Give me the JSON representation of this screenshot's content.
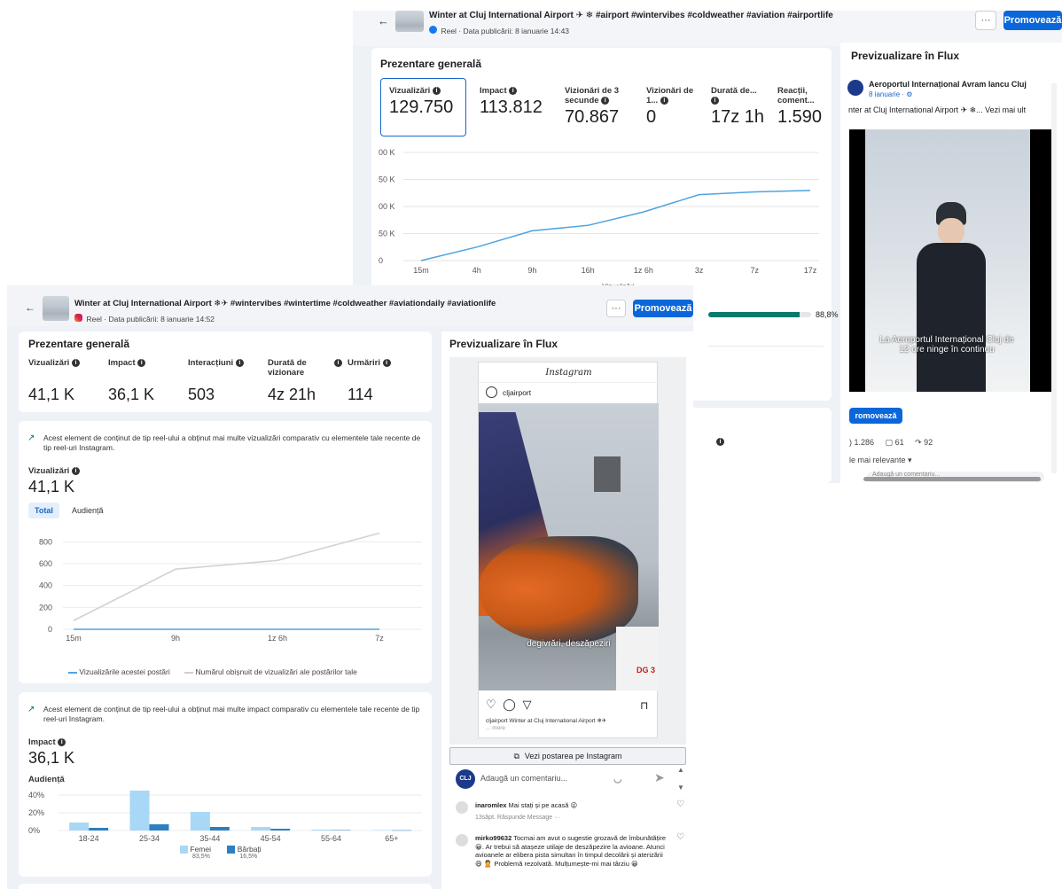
{
  "fb": {
    "title": "Winter at Cluj International Airport ✈ ❄ #airport #wintervibes #coldweather #aviation #airportlife",
    "subtitle": "Reel · Data publicării: 8 ianuarie 14:43",
    "more_label": "···",
    "promo_label": "Promovează",
    "overview_title": "Prezentare generală",
    "metrics": [
      {
        "label": "Vizualizări",
        "value": "129.750"
      },
      {
        "label": "Impact",
        "value": "113.812"
      },
      {
        "label": "Vizionări de 3 secunde",
        "value": "70.867"
      },
      {
        "label": "Vizionări de 1...",
        "value": "0"
      },
      {
        "label": "Durată de...",
        "value": "17z 1h"
      },
      {
        "label": "Reacții, coment...",
        "value": "1.590"
      }
    ],
    "chart_y_ticks": [
      "00 K",
      "50 K",
      "00 K",
      "50 K",
      "0"
    ],
    "chart_x_ticks": [
      "15m",
      "4h",
      "9h",
      "16h",
      "1z 6h",
      "3z",
      "7z",
      "17z"
    ],
    "legend_label": "Vizualizări",
    "progress_value": "88,8%",
    "progress_fraction": 0.888,
    "preview_title": "Previzualizare în Flux",
    "preview_page": "Aeroportul Internațional Avram Iancu Cluj",
    "preview_date": "8 ianuarie · ⚙",
    "preview_text": "nter at Cluj International Airport ✈ ❄... Vezi mai ult",
    "video_caption": "La Aeroportul Internațional Cluj de 12 ore ninge în continuu",
    "preview_promo": "romovează",
    "reactions": ") 1.286",
    "comments": "61",
    "shares": "92",
    "sort_label": "le mai relevante ▾",
    "comment_placeholder": "Adaugă un comentariu..."
  },
  "ig": {
    "title": "Winter at Cluj International Airport ❄✈ #wintervibes #wintertime #coldweather #aviationdaily #aviationlife",
    "subtitle": "Reel · Data publicării: 8 ianuarie 14:52",
    "more_label": "···",
    "promo_label": "Promovează",
    "overview_title": "Prezentare generală",
    "metrics": [
      {
        "label": "Vizualizări",
        "value": "41,1 K"
      },
      {
        "label": "Impact",
        "value": "36,1 K"
      },
      {
        "label": "Interacțiuni",
        "value": "503"
      },
      {
        "label": "Durată de vizionare",
        "value": "4z 21h"
      },
      {
        "label": "Urmăriri",
        "value": "114"
      }
    ],
    "insight1": "Acest element de conținut de tip reel-ului a obținut mai multe vizualizări comparativ cu elementele tale recente de tip reel-uri Instagram.",
    "views_label": "Vizualizări",
    "views_value": "41,1 K",
    "tab_total": "Total",
    "tab_audience": "Audiență",
    "chart_legend_1": "Vizualizările acestei postări",
    "chart_legend_2": "Numărul obișnuit de vizualizări ale postărilor tale",
    "insight2": "Acest element de conținut de tip reel-ului a obținut mai multe impact comparativ cu elementele tale recente de tip reel-uri Instagram.",
    "impact_label": "Impact",
    "impact_value": "36,1 K",
    "audience_label": "Audiență",
    "legend_f": "Femei",
    "legend_f_pct": "83,5%",
    "legend_m": "Bărbați",
    "legend_m_pct": "16,5%",
    "preview_title": "Previzualizare în Flux",
    "ig_logo": "Instagram",
    "account": "cljairport",
    "photo_caption": "degivrări, deszăpeziri",
    "truck_text": "DG 3",
    "post_caption": "cljairport Winter at Cluj International Airport ❄✈",
    "post_more": "... more",
    "view_on_ig": "Vezi postarea pe Instagram",
    "comment_placeholder": "Adaugă un comentariu...",
    "comments": [
      {
        "user": "inaromlex",
        "text": "Mai stați și pe acasă 😜",
        "meta": "13săpt.   Răspunde   Message   ···"
      },
      {
        "user": "mirko99632",
        "text": "Tocmai am avut o sugestie grozavă de îmbunătățire 😀. Ar trebui să atașeze utilaje de deszăpezire la avioane. Atunci avioanele ar elibera pista simultan în timpul decolării și aterizării 😄 🙎 Problemă rezolvată. Mulțumește-mi mai târziu 😀",
        "meta": ""
      }
    ]
  },
  "chart_data": [
    {
      "type": "line",
      "title": "",
      "x": [
        "15m",
        "4h",
        "9h",
        "16h",
        "1z 6h",
        "3z",
        "7z",
        "17z"
      ],
      "series": [
        {
          "name": "Vizualizări",
          "values": [
            0,
            25000,
            55000,
            65000,
            90000,
            122000,
            127000,
            129750
          ]
        }
      ],
      "ylabel": "",
      "ylim": [
        0,
        200000
      ],
      "grid": true,
      "legend": "bottom"
    },
    {
      "type": "line",
      "title": "",
      "x": [
        "15m",
        "9h",
        "1z 6h",
        "7z"
      ],
      "series": [
        {
          "name": "Vizualizările acestei postări",
          "values": [
            0,
            0,
            0,
            0
          ]
        },
        {
          "name": "Numărul obișnuit de vizualizări ale postărilor tale",
          "values": [
            80,
            550,
            630,
            880
          ]
        }
      ],
      "ylim": [
        0,
        900
      ],
      "yticks": [
        0,
        200,
        400,
        600,
        800
      ],
      "grid": true,
      "legend": "bottom"
    },
    {
      "type": "bar",
      "title": "",
      "categories": [
        "18-24",
        "25-34",
        "35-44",
        "45-54",
        "55-64",
        "65+"
      ],
      "series": [
        {
          "name": "Femei",
          "values": [
            9,
            45,
            21,
            4,
            1,
            0.5
          ],
          "color": "#a8d8f5"
        },
        {
          "name": "Bărbați",
          "values": [
            3,
            7,
            4,
            2,
            0.5,
            0.3
          ],
          "color": "#2d7fc1"
        }
      ],
      "ylim": [
        0,
        40
      ],
      "yticks": [
        "0%",
        "20%",
        "40%"
      ],
      "legend": "bottom"
    }
  ]
}
